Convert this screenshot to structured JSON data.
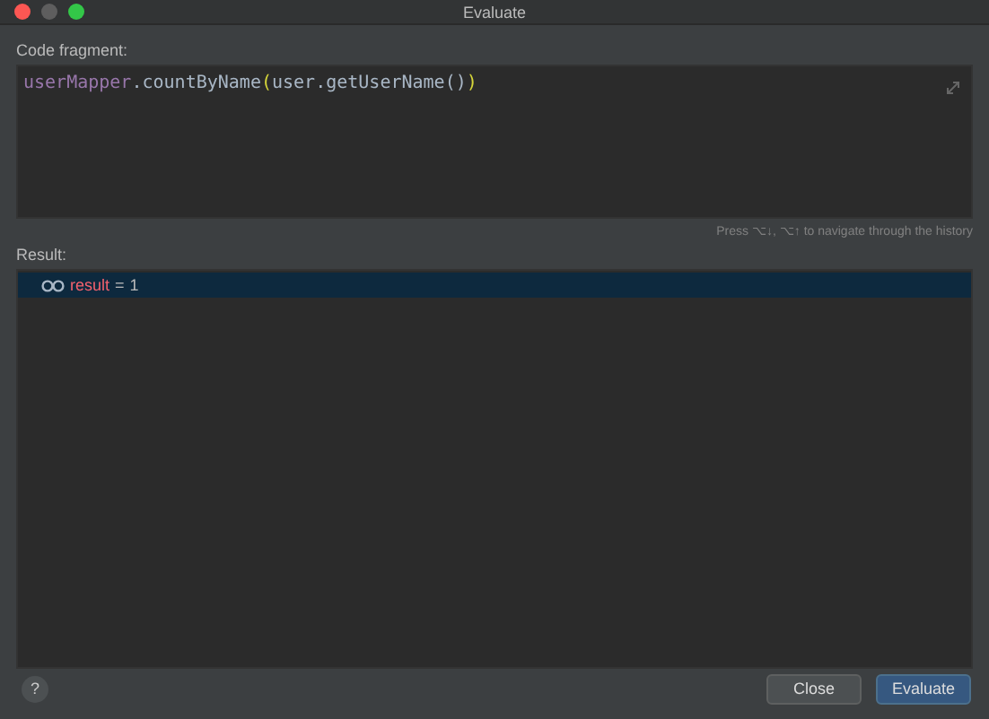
{
  "window": {
    "title": "Evaluate"
  },
  "code_fragment": {
    "label": "Code fragment:",
    "tokens": [
      {
        "text": "userMapper",
        "kind": "field"
      },
      {
        "text": ".countByName",
        "kind": "plain"
      },
      {
        "text": "(",
        "kind": "brace"
      },
      {
        "text": "user.getUserName()",
        "kind": "plain"
      },
      {
        "text": ")",
        "kind": "brace"
      }
    ]
  },
  "history_hint": "Press ⌥↓, ⌥↑ to navigate through the history",
  "result": {
    "label": "Result:",
    "rows": [
      {
        "name": "result",
        "equals": "=",
        "value": "1",
        "selected": true
      }
    ]
  },
  "buttons": [
    {
      "label": "Close",
      "kind": "secondary"
    },
    {
      "label": "Evaluate",
      "kind": "primary"
    }
  ],
  "help": "?"
}
